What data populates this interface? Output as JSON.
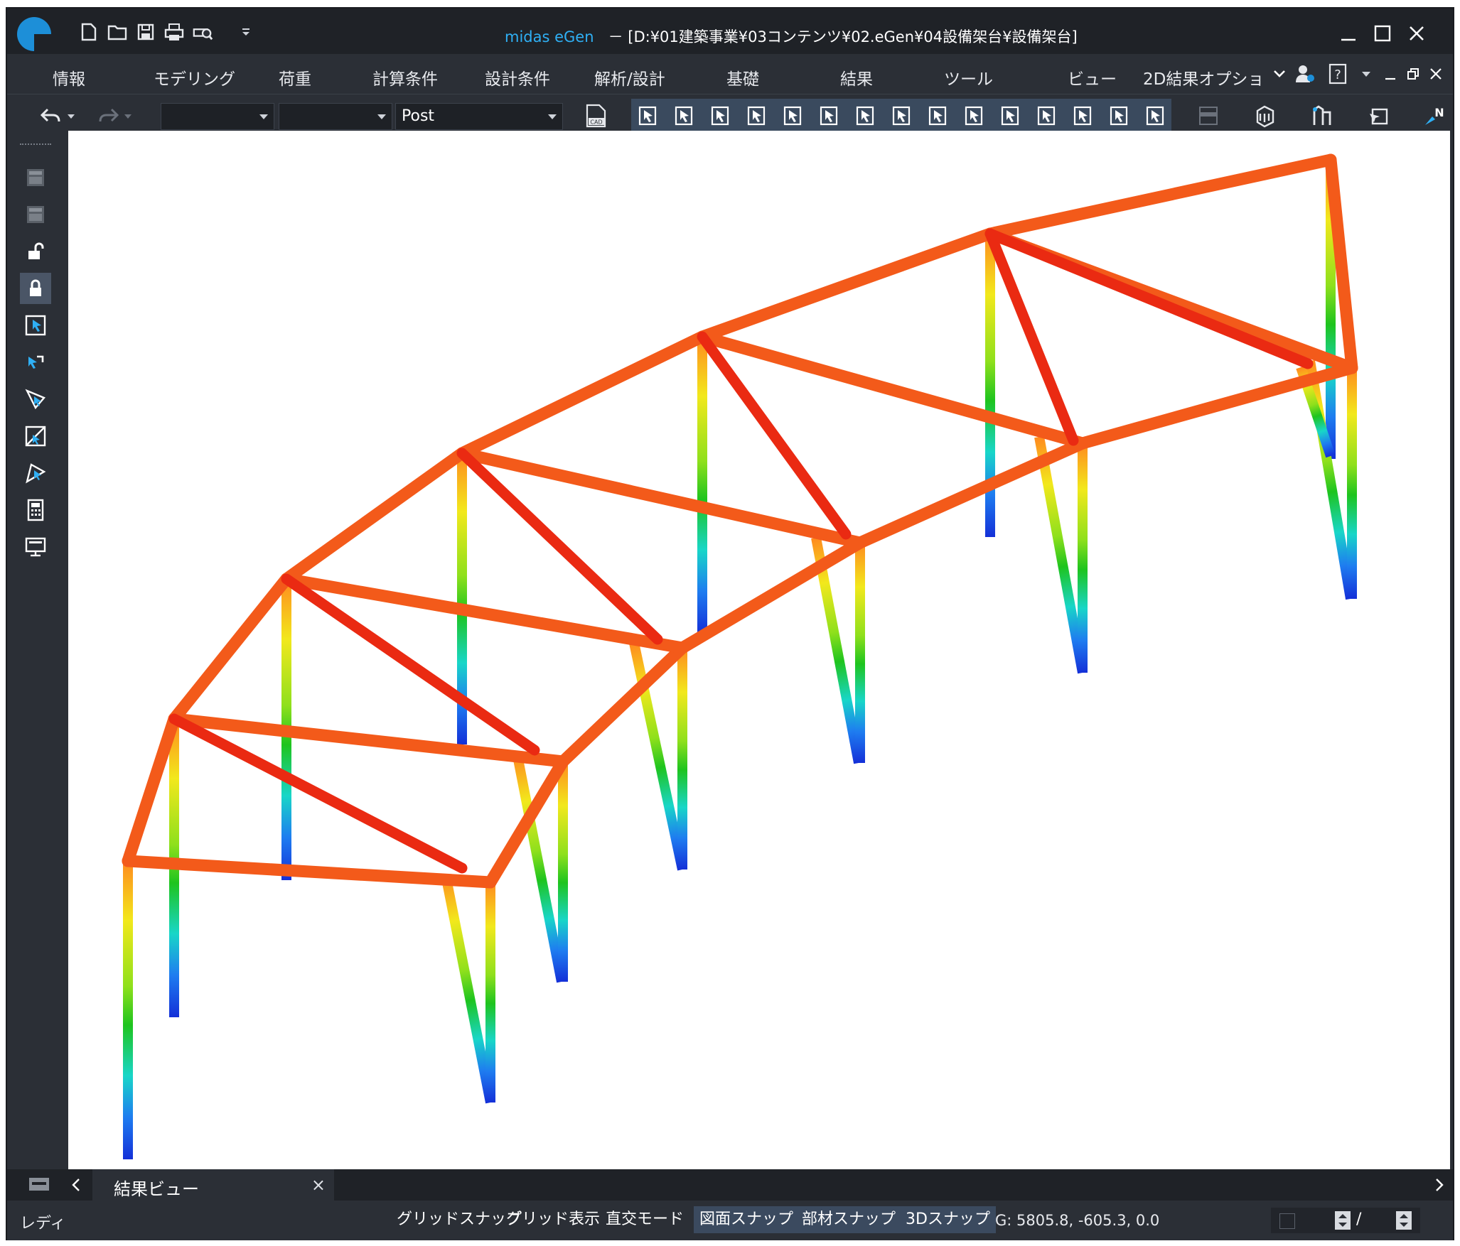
{
  "titlebar": {
    "app_name": "midas eGen",
    "separator": "－",
    "document": "[D:¥01建築事業¥03コンテンツ¥02.eGen¥04設備架台¥設備架台]",
    "quick_access": [
      "new-file-icon",
      "open-folder-icon",
      "save-icon",
      "print-icon",
      "print-preview-icon",
      "customize-dropdown-icon"
    ]
  },
  "menu": {
    "items": [
      "情報",
      "モデリング",
      "荷重",
      "計算条件",
      "設計条件",
      "解析/設計",
      "基礎",
      "結果",
      "ツール",
      "ビュー",
      "2D結果オプショ"
    ],
    "overflow_arrow": "⌄"
  },
  "toolbar": {
    "combo1_value": "",
    "combo2_value": "",
    "combo3_value": "Post",
    "cad_label": "CAD",
    "north_label": "N"
  },
  "colors": {
    "accent": "#1d8fd8",
    "title_app": "#2fb0f5",
    "chrome_dark": "#2b2f36",
    "titlebar": "#1f2227",
    "beam_orange": "#f25a1e",
    "beam_red": "#ea2a14"
  },
  "results_view": {
    "type": "3D frame result contour",
    "legend": "none"
  },
  "tabs": {
    "active_label": "結果ビュー",
    "close": "×"
  },
  "status": {
    "ready": "レディ",
    "snaps": [
      "グリッドスナップ",
      "グリッド表示",
      "直交モード",
      "図面スナップ",
      "部材スナップ",
      "3Dスナップ"
    ],
    "snaps_on": [
      false,
      false,
      false,
      true,
      true,
      true
    ],
    "coordinates": "G: 5805.8, -605.3, 0.0",
    "page_separator": "/"
  }
}
